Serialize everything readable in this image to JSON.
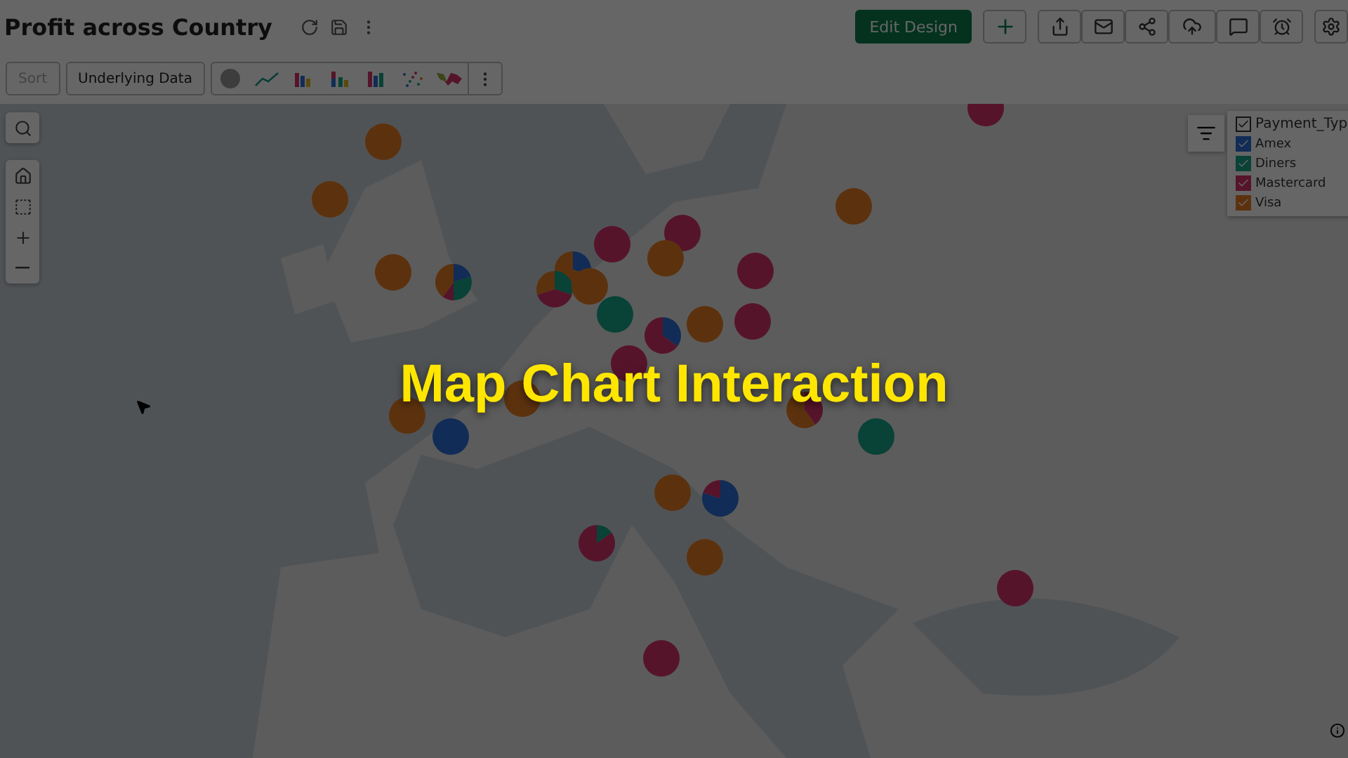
{
  "window": {
    "title": "Profit across Country"
  },
  "header": {
    "edit_button": "Edit Design"
  },
  "toolbar": {
    "sort": {
      "label": "Sort",
      "disabled": true
    },
    "underlying_data": {
      "label": "Underlying Data",
      "disabled": false
    }
  },
  "legend": {
    "title": "Payment_Typ",
    "checked": true,
    "items": [
      {
        "label": "Amex",
        "color": "#112c56",
        "checked": true
      },
      {
        "label": "Diners",
        "color": "#094237",
        "checked": true
      },
      {
        "label": "Mastercard",
        "color": "#56142b",
        "checked": true
      },
      {
        "label": "Visa",
        "color": "#5c320e",
        "checked": true
      }
    ]
  },
  "overlay": {
    "caption": "Map Chart Interaction"
  }
}
